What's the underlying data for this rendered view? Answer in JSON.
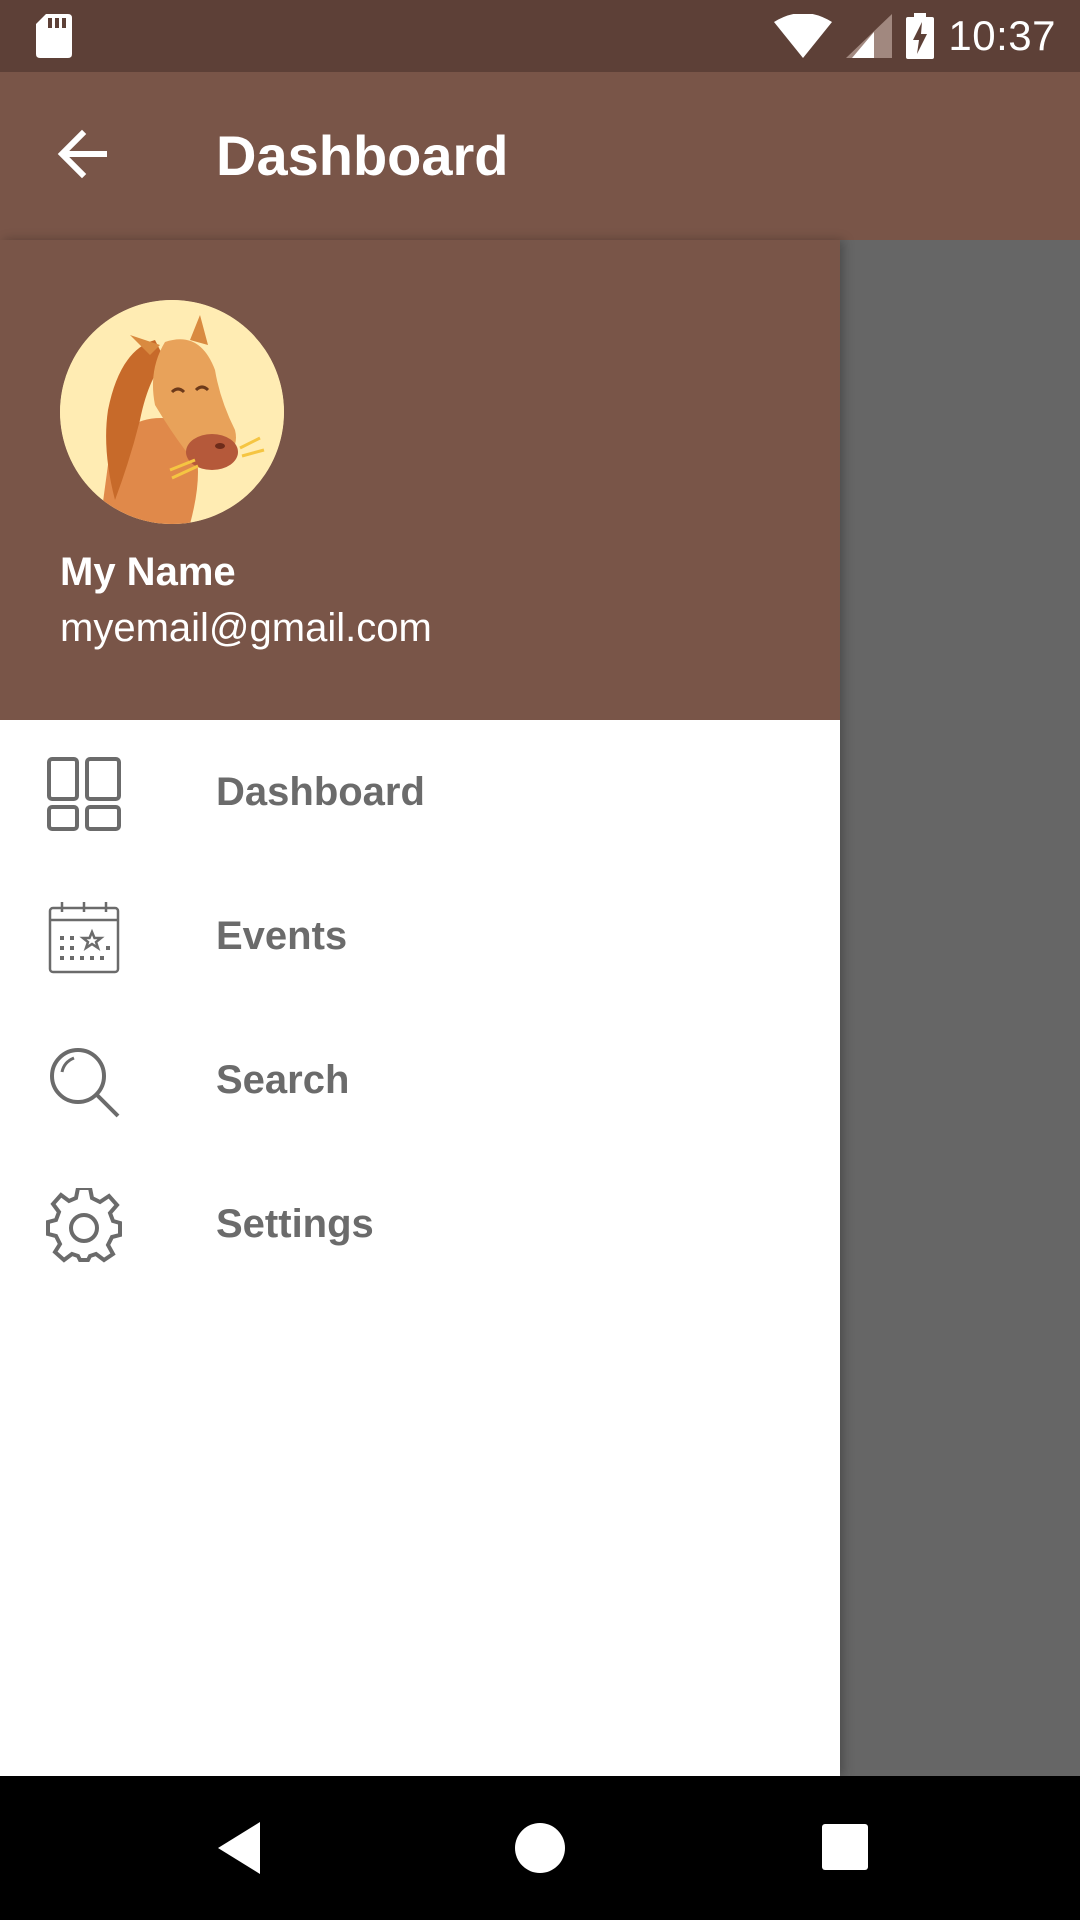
{
  "status_bar": {
    "time": "10:37",
    "icons": [
      "sd-card-icon",
      "wifi-icon",
      "signal-icon",
      "battery-charging-icon"
    ]
  },
  "app_bar": {
    "title": "Dashboard",
    "back_icon": "arrow-back-icon"
  },
  "drawer": {
    "header": {
      "avatar_icon": "horse-avatar",
      "name": "My Name",
      "email": "myemail@gmail.com"
    },
    "items": [
      {
        "label": "Dashboard",
        "icon": "dashboard-icon"
      },
      {
        "label": "Events",
        "icon": "calendar-icon"
      },
      {
        "label": "Search",
        "icon": "search-icon"
      },
      {
        "label": "Settings",
        "icon": "gear-icon"
      }
    ]
  },
  "nav_bar": {
    "icons": [
      "nav-back-icon",
      "nav-home-icon",
      "nav-recents-icon"
    ]
  },
  "colors": {
    "status_bar": "#5d4037",
    "primary": "#795548",
    "scrim": "#666666",
    "menu_text": "#6b6b6b"
  }
}
